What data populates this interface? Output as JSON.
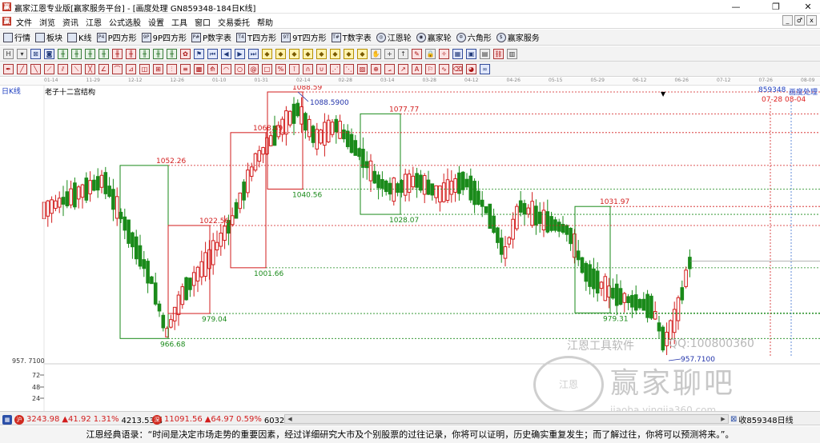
{
  "window": {
    "title": "赢家江恩专业版[赢家服务平台] - [画度处理 GN859348-184日K线]",
    "minimize": "—",
    "restore": "❐",
    "close": "✕"
  },
  "menu": {
    "items": [
      "文件",
      "浏览",
      "资讯",
      "江恩",
      "公式选股",
      "设置",
      "工具",
      "窗口",
      "交易委托",
      "帮助"
    ],
    "mdi": [
      "_",
      "♂",
      "x"
    ]
  },
  "toolbar1": {
    "items": [
      {
        "label": "行情",
        "icon": "grid-icon"
      },
      {
        "label": "板块",
        "icon": "blocks-icon"
      },
      {
        "label": "K线",
        "icon": "candle-icon"
      },
      {
        "label": "P四方形",
        "icon": "p-square-icon",
        "glyph": "P4"
      },
      {
        "label": "9P四方形",
        "icon": "9p-square-icon",
        "glyph": "9P"
      },
      {
        "label": "P数字表",
        "icon": "p-table-icon",
        "glyph": "P#"
      },
      {
        "label": "T四方形",
        "icon": "t-square-icon",
        "glyph": "T4"
      },
      {
        "label": "9T四方形",
        "icon": "9t-square-icon",
        "glyph": "9T"
      },
      {
        "label": "T数字表",
        "icon": "t-table-icon",
        "glyph": "T#"
      },
      {
        "label": "江恩轮",
        "icon": "gann-wheel-icon",
        "glyph": "◎"
      },
      {
        "label": "赢家轮",
        "icon": "winner-wheel-icon",
        "glyph": "◉"
      },
      {
        "label": "六角形",
        "icon": "hexagon-icon",
        "glyph": "✡"
      },
      {
        "label": "赢家服务",
        "icon": "service-icon",
        "glyph": "$"
      }
    ]
  },
  "toolbar2": {
    "icons": [
      {
        "name": "period-h-icon",
        "glyph": "H",
        "c": ""
      },
      {
        "name": "period-dropdown-icon",
        "glyph": "▾",
        "c": ""
      },
      {
        "name": "chart-type-icon",
        "glyph": "⊠",
        "c": "b"
      },
      {
        "name": "fund-icon",
        "glyph": "◙",
        "c": "b"
      },
      {
        "name": "kline-1-icon",
        "glyph": "╫",
        "c": "g"
      },
      {
        "name": "kline-2-icon",
        "glyph": "╫",
        "c": "g"
      },
      {
        "name": "kline-3-icon",
        "glyph": "╫",
        "c": "g"
      },
      {
        "name": "kline-4-icon",
        "glyph": "╫",
        "c": "g"
      },
      {
        "name": "kline-5-icon",
        "glyph": "╫",
        "c": "r"
      },
      {
        "name": "kline-6-icon",
        "glyph": "╫",
        "c": "r"
      },
      {
        "name": "kline-7-icon",
        "glyph": "╫",
        "c": "g"
      },
      {
        "name": "kline-8-icon",
        "glyph": "╫",
        "c": "g"
      },
      {
        "name": "kline-9-icon",
        "glyph": "╫",
        "c": "g"
      },
      {
        "name": "indicator-icon",
        "glyph": "✿",
        "c": "r"
      },
      {
        "name": "flag-icon",
        "glyph": "⚑",
        "c": "b"
      },
      {
        "name": "nav-first-icon",
        "glyph": "⏮",
        "c": "b"
      },
      {
        "name": "nav-prev-icon",
        "glyph": "◀",
        "c": "b"
      },
      {
        "name": "nav-next-icon",
        "glyph": "▶",
        "c": "b"
      },
      {
        "name": "nav-last-icon",
        "glyph": "⏭",
        "c": "b"
      },
      {
        "name": "diamond-1-icon",
        "glyph": "◆",
        "c": "y"
      },
      {
        "name": "diamond-2-icon",
        "glyph": "◆",
        "c": "y"
      },
      {
        "name": "diamond-3-icon",
        "glyph": "◆",
        "c": "y"
      },
      {
        "name": "diamond-4-icon",
        "glyph": "◆",
        "c": "y"
      },
      {
        "name": "diamond-5-icon",
        "glyph": "◆",
        "c": "y"
      },
      {
        "name": "diamond-6-icon",
        "glyph": "◆",
        "c": "y"
      },
      {
        "name": "diamond-7-icon",
        "glyph": "◆",
        "c": "y"
      },
      {
        "name": "diamond-8-icon",
        "glyph": "◆",
        "c": "y"
      },
      {
        "name": "hand-icon",
        "glyph": "✋",
        "c": ""
      },
      {
        "name": "cross-icon",
        "glyph": "+",
        "c": ""
      },
      {
        "name": "arrow-up-icon",
        "glyph": "↑",
        "c": ""
      },
      {
        "name": "draw-icon",
        "glyph": "✎",
        "c": "r"
      },
      {
        "name": "lock-icon",
        "glyph": "🔒",
        "c": ""
      },
      {
        "name": "magic-icon",
        "glyph": "✧",
        "c": "r"
      },
      {
        "name": "calc-icon",
        "glyph": "▦",
        "c": "b"
      },
      {
        "name": "save-icon",
        "glyph": "▣",
        "c": "b"
      },
      {
        "name": "print-icon",
        "glyph": "▤",
        "c": ""
      },
      {
        "name": "link-icon",
        "glyph": "⛓",
        "c": "r"
      },
      {
        "name": "info-icon",
        "glyph": "▥",
        "c": ""
      }
    ]
  },
  "toolbar3": {
    "icons": [
      {
        "name": "pen-icon",
        "glyph": "✒",
        "c": "r"
      },
      {
        "name": "line-1-icon",
        "glyph": "╱",
        "c": "r"
      },
      {
        "name": "line-2-icon",
        "glyph": "╲",
        "c": "r"
      },
      {
        "name": "line-3-icon",
        "glyph": "⟋",
        "c": "r"
      },
      {
        "name": "line-4-icon",
        "glyph": "⫽",
        "c": "r"
      },
      {
        "name": "line-5-icon",
        "glyph": "⟍",
        "c": "r"
      },
      {
        "name": "line-6-icon",
        "glyph": "╳",
        "c": "r"
      },
      {
        "name": "line-7-icon",
        "glyph": "∠",
        "c": "r"
      },
      {
        "name": "line-8-icon",
        "glyph": "⌒",
        "c": "r"
      },
      {
        "name": "line-9-icon",
        "glyph": "⊿",
        "c": "r"
      },
      {
        "name": "line-10-icon",
        "glyph": "◫",
        "c": "r"
      },
      {
        "name": "line-11-icon",
        "glyph": "⊞",
        "c": "r"
      },
      {
        "name": "line-12-icon",
        "glyph": "⫶",
        "c": "r"
      },
      {
        "name": "fib-icon",
        "glyph": "≡",
        "c": "r"
      },
      {
        "name": "grid-draw-icon",
        "glyph": "▩",
        "c": "r"
      },
      {
        "name": "fan-icon",
        "glyph": "⟰",
        "c": "r"
      },
      {
        "name": "arc-icon",
        "glyph": "◠",
        "c": "r"
      },
      {
        "name": "circle-icon",
        "glyph": "○",
        "c": "r"
      },
      {
        "name": "spiral-icon",
        "glyph": "@",
        "c": "r"
      },
      {
        "name": "rect-icon",
        "glyph": "□",
        "c": "r"
      },
      {
        "name": "percent-icon",
        "glyph": "%",
        "c": "r"
      },
      {
        "name": "time-icon",
        "glyph": "⊺",
        "c": "r"
      },
      {
        "name": "cycle-icon",
        "glyph": "∩",
        "c": "r"
      },
      {
        "name": "cycle2-icon",
        "glyph": "∪",
        "c": "r"
      },
      {
        "name": "speed-icon",
        "glyph": "⋰",
        "c": "r"
      },
      {
        "name": "gann-fan-icon",
        "glyph": "⋱",
        "c": "r"
      },
      {
        "name": "gann-box-icon",
        "glyph": "▨",
        "c": "r"
      },
      {
        "name": "square9-icon",
        "glyph": "⊕",
        "c": "r"
      },
      {
        "name": "angle-icon",
        "glyph": "⦟",
        "c": "r"
      },
      {
        "name": "ray-icon",
        "glyph": "↗",
        "c": "r"
      },
      {
        "name": "text-icon",
        "glyph": "A",
        "c": "r"
      },
      {
        "name": "mark-icon",
        "glyph": "⚐",
        "c": "r"
      },
      {
        "name": "wave-icon",
        "glyph": "∿",
        "c": "r"
      },
      {
        "name": "erase-icon",
        "glyph": "⌫",
        "c": "r"
      },
      {
        "name": "palette-icon",
        "glyph": "◕",
        "c": "r"
      },
      {
        "name": "infinity-icon",
        "glyph": "∞",
        "c": "b"
      }
    ]
  },
  "timeline": {
    "dates": [
      "01-14",
      "11-29",
      "12-12",
      "12-26",
      "01-10",
      "01-31",
      "02-14",
      "02-28",
      "03-14",
      "03-28",
      "04-12",
      "04-26",
      "05-15",
      "05-29",
      "06-12",
      "06-26",
      "07-12",
      "07-26",
      "08-09"
    ]
  },
  "chart": {
    "period": "日K线",
    "indicator": "老子十二宫结构",
    "code": "859348",
    "mode": "画度处理",
    "date_range": "07-28 08-04",
    "price_label": "957. 7100",
    "axis_ticks": [
      "72",
      "48",
      "24"
    ],
    "up_color": "#d21c1c",
    "down_color": "#1a8a1a",
    "box_up_color": "#d21c1c",
    "box_down_color": "#1a8a1a"
  },
  "chart_data": {
    "type": "candlestick",
    "levels_red": [
      {
        "label": "1088.59",
        "value": 1088.59
      },
      {
        "label": "1077.77",
        "value": 1077.77
      },
      {
        "label": "1068.49",
        "value": 1068.49
      },
      {
        "label": "1052.26",
        "value": 1052.26
      },
      {
        "label": "1031.97",
        "value": 1031.97
      },
      {
        "label": "1022.56",
        "value": 1022.56
      }
    ],
    "levels_green": [
      {
        "label": "1040.56",
        "value": 1040.56
      },
      {
        "label": "1028.07",
        "value": 1028.07
      },
      {
        "label": "1001.66",
        "value": 1001.66
      },
      {
        "label": "979.04",
        "value": 979.04
      },
      {
        "label": "979.31",
        "value": 979.31
      },
      {
        "label": "966.68",
        "value": 966.68
      }
    ],
    "extremes": [
      {
        "label": "1088.5900",
        "value": 1088.59,
        "kind": "high"
      },
      {
        "label": "957.7100",
        "value": 957.71,
        "kind": "low"
      }
    ]
  },
  "watermark": {
    "line1": "江恩工具软件",
    "line2": "QQ:100800360",
    "big": "赢家聊吧",
    "small": "jiaoba.yingjia360.com",
    "seal": "江恩"
  },
  "statusbar": {
    "sh_value": "3243.98",
    "sh_change": "▲41.92",
    "sh_pct": "1.31%",
    "sh_amount": "4213.53亿",
    "sz_value": "11091.56",
    "sz_change": "▲64.97",
    "sz_pct": "0.59%",
    "sz_amount": "6032.32亿",
    "right_label": "收859348日线"
  },
  "quote": "江恩经典语录：“时间是决定市场走势的重要因素，经过详细研究大市及个别股票的过往记录，你将可以证明，历史确实重复发生；而了解过往，你将可以预测将来。”。"
}
